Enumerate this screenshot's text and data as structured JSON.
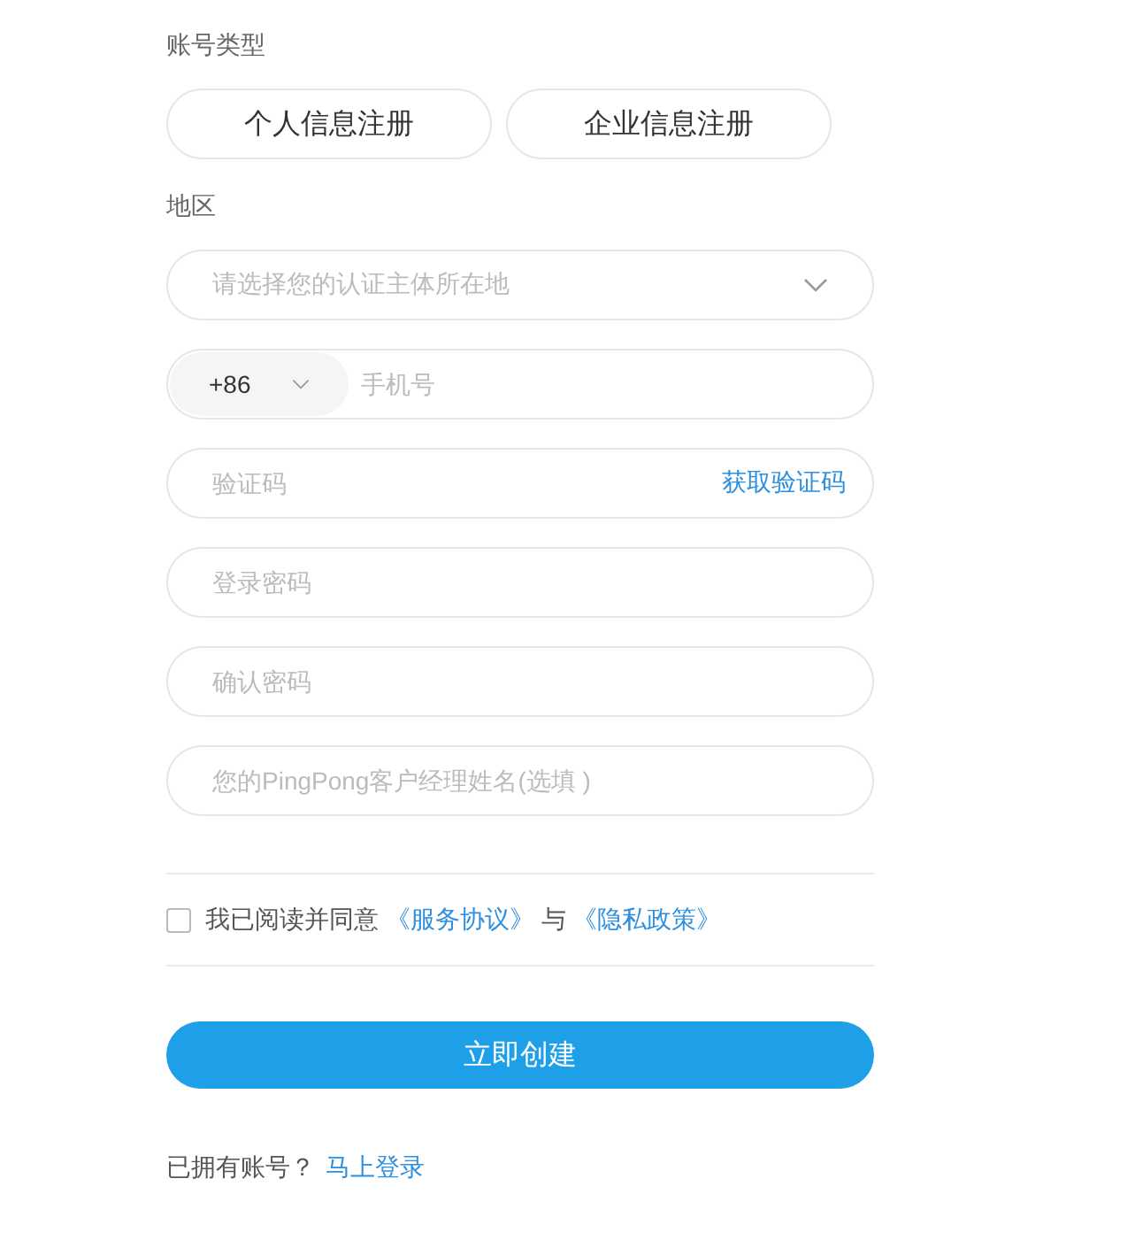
{
  "account_type": {
    "label": "账号类型",
    "options": [
      {
        "label": "个人信息注册",
        "selected": false
      },
      {
        "label": "企业信息注册",
        "selected": false
      }
    ]
  },
  "region": {
    "label": "地区",
    "placeholder": "请选择您的认证主体所在地"
  },
  "fields": [
    {
      "kind": "phone",
      "country_code": "+86",
      "placeholder": "手机号"
    },
    {
      "kind": "code",
      "placeholder": "验证码",
      "action": "获取验证码"
    },
    {
      "kind": "password",
      "placeholder": "登录密码"
    },
    {
      "kind": "password",
      "placeholder": "确认密码"
    },
    {
      "kind": "text",
      "placeholder": "您的PingPong客户经理姓名(选填 )"
    }
  ],
  "agreement": {
    "checked": false,
    "parts": [
      {
        "kind": "text",
        "text": "我已阅读并同意"
      },
      {
        "kind": "link",
        "text": "《服务协议》"
      },
      {
        "kind": "text",
        "text": "与"
      },
      {
        "kind": "link",
        "text": "《隐私政策》"
      }
    ]
  },
  "submit": "立即创建",
  "login": {
    "prompt": "已拥有账号？",
    "link": "马上登录"
  }
}
